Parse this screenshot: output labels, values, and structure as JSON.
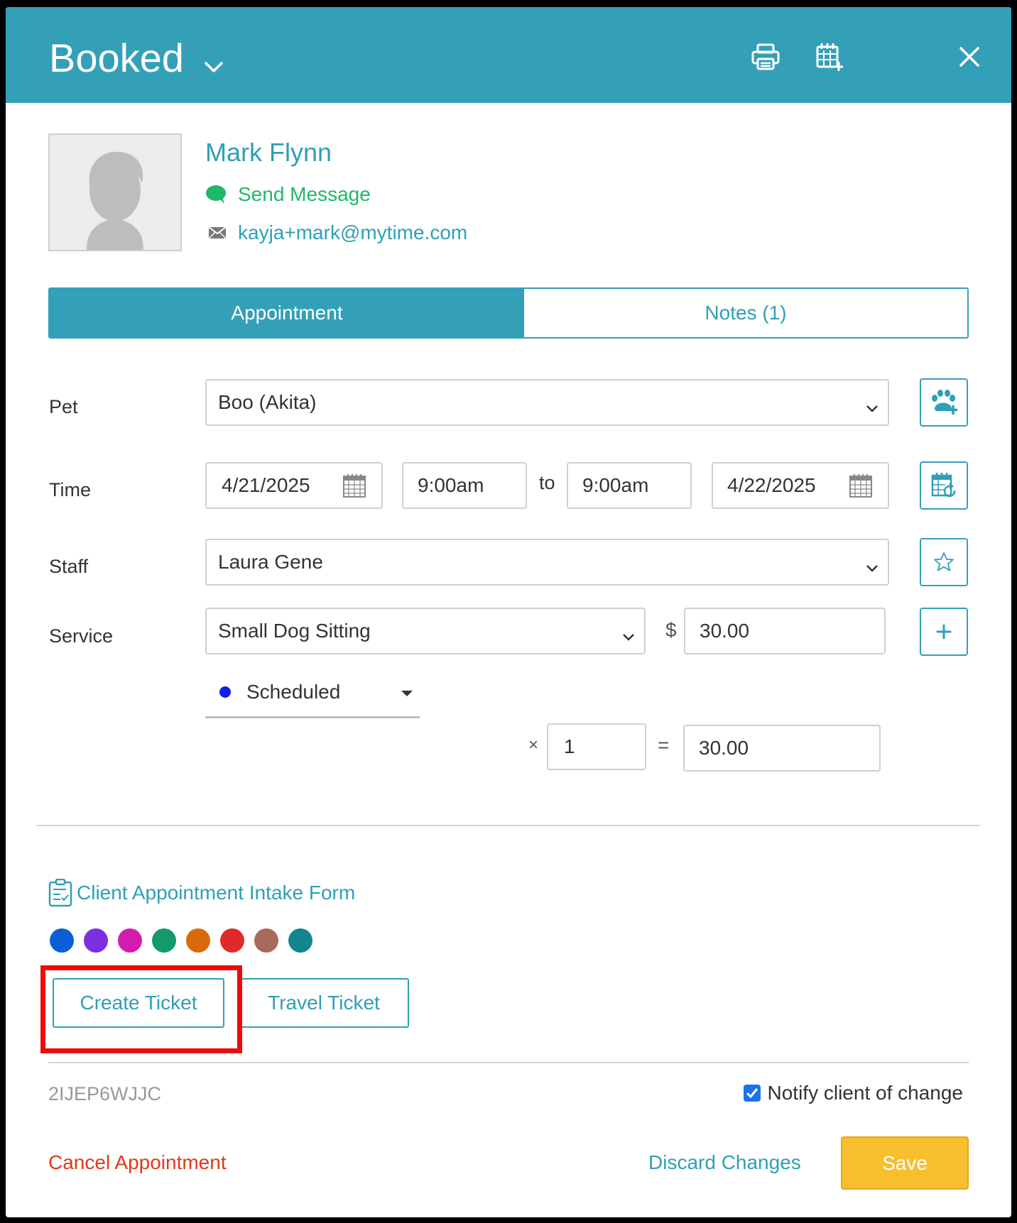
{
  "header": {
    "status": "Booked",
    "print_icon": "printer-icon",
    "calendar_add_icon": "calendar-plus-icon",
    "close_icon": "close-icon"
  },
  "client": {
    "name": "Mark Flynn",
    "send_message": "Send Message",
    "email": "kayja+mark@mytime.com"
  },
  "tabs": [
    {
      "label": "Appointment",
      "active": true
    },
    {
      "label": "Notes (1)",
      "active": false
    }
  ],
  "form": {
    "pet_label": "Pet",
    "pet_value": "Boo (Akita)",
    "time_label": "Time",
    "start_date": "4/21/2025",
    "start_time": "9:00am",
    "to_label": "to",
    "end_time": "9:00am",
    "end_date": "4/22/2025",
    "staff_label": "Staff",
    "staff_value": "Laura Gene",
    "service_label": "Service",
    "service_value": "Small Dog Sitting",
    "currency": "$",
    "price": "30.00",
    "status_value": "Scheduled",
    "status_color": "#1020e8",
    "multiply_sign": "×",
    "quantity": "1",
    "equals_sign": "=",
    "total": "30.00"
  },
  "intake_form": "Client Appointment Intake Form",
  "color_swatches": [
    "#0b5fd6",
    "#7b2fe0",
    "#d41bb0",
    "#149a6a",
    "#d96a0a",
    "#e02a2a",
    "#a86a5a",
    "#13858f"
  ],
  "buttons": {
    "create_ticket": "Create Ticket",
    "travel_ticket": "Travel Ticket",
    "cancel_appointment": "Cancel Appointment",
    "discard_changes": "Discard Changes",
    "save": "Save"
  },
  "footer": {
    "appointment_code": "2IJEP6WJJC",
    "notify_label": "Notify client of change",
    "notify_checked": true
  },
  "colors": {
    "accent": "#34a0b8",
    "link": "#2f9fb6",
    "success": "#1fb866",
    "danger": "#e0391b",
    "save": "#f7bf2e",
    "highlight": "#f00a0a"
  }
}
